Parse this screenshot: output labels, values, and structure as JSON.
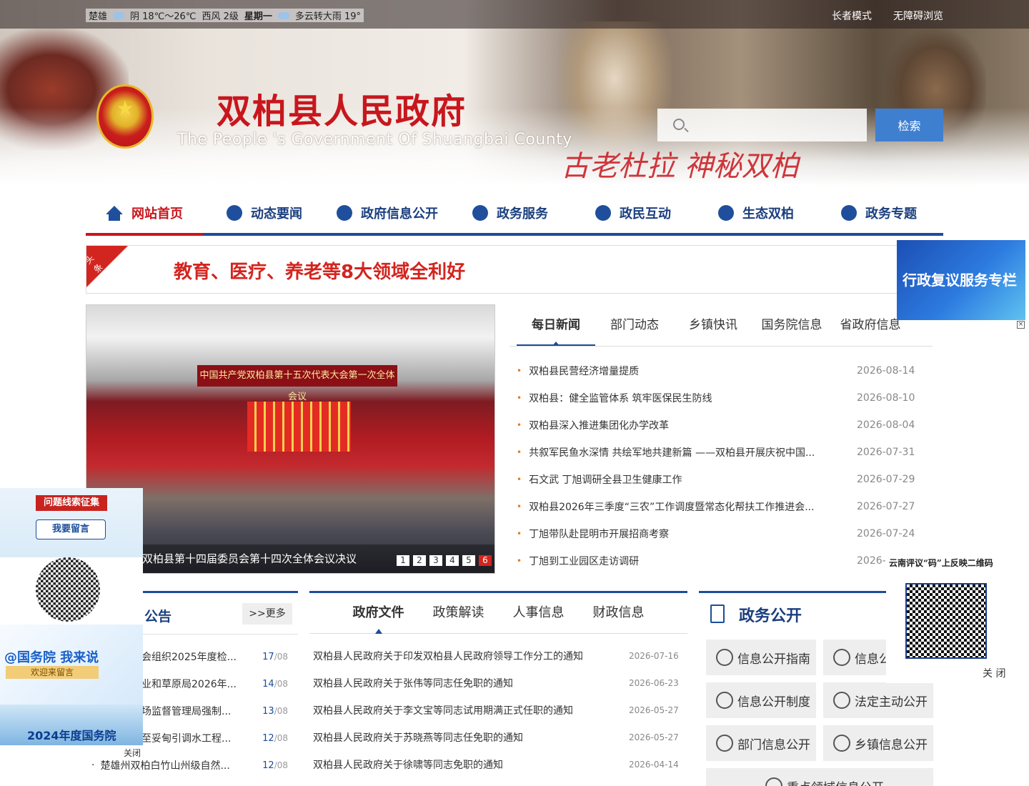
{
  "topbar": {
    "weather": {
      "city": "楚雄",
      "today": "阴 18℃～26℃",
      "wind": "西风 2级",
      "weekday": "星期一",
      "tomorrow": "多云转大雨 19°"
    },
    "links": [
      "长者模式",
      "无障碍浏览"
    ]
  },
  "header": {
    "title": "双柏县人民政府",
    "subtitle": "The People 's Government Of Shuangbai County",
    "slogan": "古老杜拉 神秘双柏",
    "search_placeholder": "",
    "search_button": "检索"
  },
  "nav": [
    "网站首页",
    "动态要闻",
    "政府信息公开",
    "政务服务",
    "政民互动",
    "生态双柏",
    "政务专题"
  ],
  "headline": {
    "tag": "头条",
    "text": "教育、医疗、养老等8大领域全利好"
  },
  "carousel": {
    "stage_text": "中国共产党双柏县第十五次代表大会第一次全体会议",
    "caption": "双柏县第十四届委员会第十四次全体会议决议",
    "pages": [
      "1",
      "2",
      "3",
      "4",
      "5",
      "6"
    ],
    "active_page": 6
  },
  "news": {
    "tabs": [
      "每日新闻",
      "部门动态",
      "乡镇快讯",
      "国务院信息",
      "省政府信息"
    ],
    "items": [
      {
        "title": "双柏县民营经济增量提质",
        "date": "2026-08-14"
      },
      {
        "title": "双柏县：健全监管体系 筑牢医保民生防线",
        "date": "2026-08-10"
      },
      {
        "title": "双柏县深入推进集团化办学改革",
        "date": "2026-08-04"
      },
      {
        "title": "共叙军民鱼水深情 共绘军地共建新篇 ——双柏县开展庆祝中国...",
        "date": "2026-07-31"
      },
      {
        "title": "石文武 丁旭调研全县卫生健康工作",
        "date": "2026-07-29"
      },
      {
        "title": "双柏县2026年三季度“三农”工作调度暨常态化帮扶工作推进会...",
        "date": "2026-07-27"
      },
      {
        "title": "丁旭带队赴昆明市开展招商考察",
        "date": "2026-07-24"
      },
      {
        "title": "丁旭到工业园区走访调研",
        "date": "2026-0"
      }
    ]
  },
  "notice": {
    "title": "公告",
    "more": ">>更多",
    "items": [
      {
        "title": "会组织2025年度检...",
        "day": "17",
        "month": "/08"
      },
      {
        "title": "业和草原局2026年...",
        "day": "14",
        "month": "/08"
      },
      {
        "title": "场监督管理局强制...",
        "day": "13",
        "month": "/08"
      },
      {
        "title": "至妥甸引调水工程...",
        "day": "12",
        "month": "/08"
      },
      {
        "title": "楚雄州双柏白竹山州级自然...",
        "day": "12",
        "month": "/08"
      }
    ]
  },
  "docs": {
    "tabs": [
      "政府文件",
      "政策解读",
      "人事信息",
      "财政信息"
    ],
    "items": [
      {
        "title": "双柏县人民政府关于印发双柏县人民政府领导工作分工的通知",
        "date": "2026-07-16"
      },
      {
        "title": "双柏县人民政府关于张伟等同志任免职的通知",
        "date": "2026-06-23"
      },
      {
        "title": "双柏县人民政府关于李文宝等同志试用期满正式任职的通知",
        "date": "2026-05-27"
      },
      {
        "title": "双柏县人民政府关于苏晓燕等同志任免职的通知",
        "date": "2026-05-27"
      },
      {
        "title": "双柏县人民政府关于徐啸等同志免职的通知",
        "date": "2026-04-14"
      }
    ]
  },
  "open": {
    "title": "政务公开",
    "items": [
      "信息公开指南",
      "信息公",
      "信息公开制度",
      "法定主动公开",
      "部门信息公开",
      "乡镇信息公开",
      "重点领域信息公开"
    ]
  },
  "float_right_ad": {
    "text": "行政复议服务专栏",
    "close": "×"
  },
  "float_right_qr": {
    "title": "云南评议“码”上反映二维码",
    "close": "关 闭"
  },
  "float_left": {
    "ad1_tag": "问题线索征集",
    "ad1_button": "我要留言",
    "ad3_title": "@国务院 我来说",
    "ad3_sub": "欢迎来留言",
    "ad4_title": "2024年度国务院",
    "close": "关闭"
  }
}
